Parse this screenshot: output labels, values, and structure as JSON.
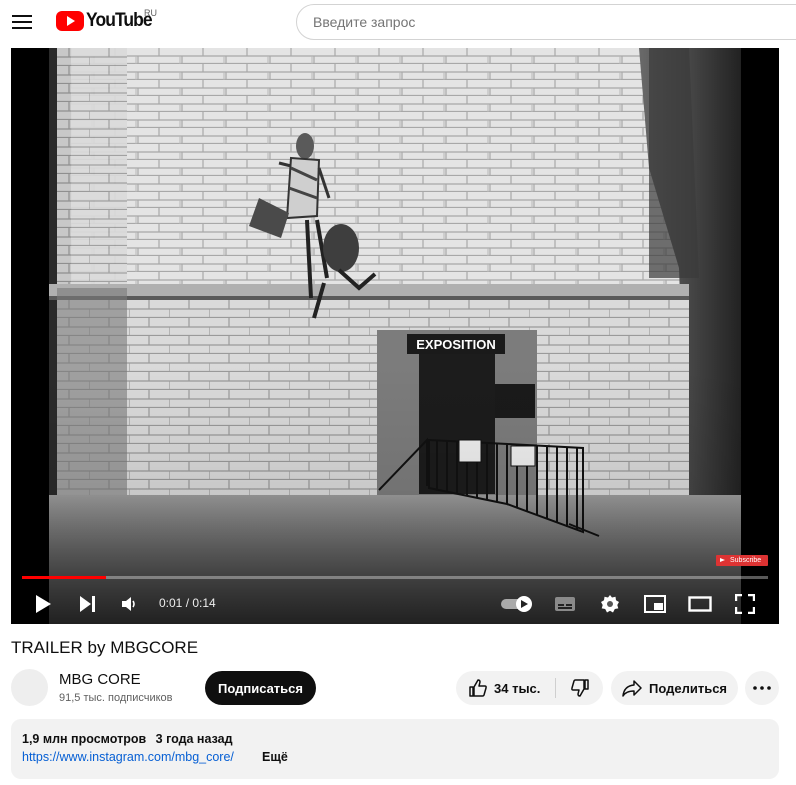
{
  "header": {
    "logo_text": "YouTube",
    "region": "RU",
    "search_placeholder": "Введите запрос"
  },
  "player": {
    "scene_sign": "EXPOSITION",
    "watermark": "Subscribe",
    "current_time": "0:01",
    "duration": "0:14",
    "time_display": "0:01 / 0:14",
    "progress_fraction": 0.113,
    "autoplay_on": true
  },
  "video": {
    "title": "TRAILER by MBGCORE"
  },
  "channel": {
    "name": "MBG CORE",
    "subscribers": "91,5 тыс. подписчиков",
    "subscribe_label": "Подписаться"
  },
  "actions": {
    "likes": "34 тыс.",
    "share_label": "Поделиться"
  },
  "description": {
    "views": "1,9 млн просмотров",
    "date": "3 года назад",
    "link": "https://www.instagram.com/mbg_core/",
    "more_label": "Ещё"
  },
  "colors": {
    "accent_red": "#ff0000",
    "link_blue": "#065fd4",
    "button_dark": "#0f0f0f",
    "pill_gray": "#f2f2f2"
  }
}
